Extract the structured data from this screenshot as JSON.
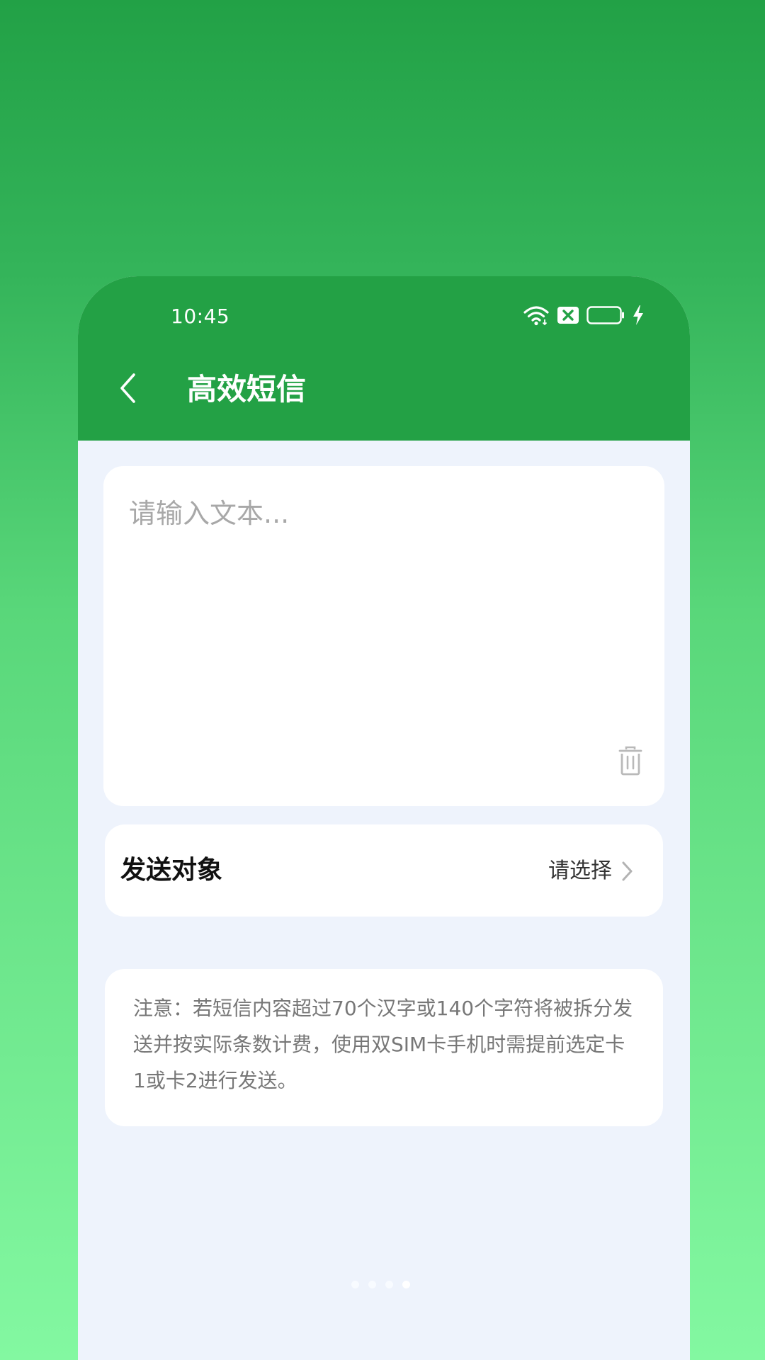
{
  "status_bar": {
    "time": "10:45",
    "icons": [
      "wifi-icon",
      "sim-off-icon",
      "battery-icon",
      "charging-icon"
    ]
  },
  "header": {
    "back_icon": "chevron-left-icon",
    "title": "高效短信"
  },
  "message_input": {
    "placeholder": "请输入文本...",
    "value": "",
    "delete_icon": "trash-icon"
  },
  "recipient": {
    "label": "发送对象",
    "value": "请选择",
    "chevron_icon": "chevron-right-icon"
  },
  "notice": {
    "text": "注意：若短信内容超过70个汉字或140个字符将被拆分发送并按实际条数计费，使用双SIM卡手机时需提前选定卡1或卡2进行发送。"
  },
  "page_indicator": {
    "count": 4,
    "active_index": 3
  },
  "colors": {
    "header_bg": "#23a145",
    "page_bg": "#eef3fc",
    "card_bg": "#ffffff",
    "placeholder_text": "#a8a8a8",
    "notice_text": "#777777"
  }
}
